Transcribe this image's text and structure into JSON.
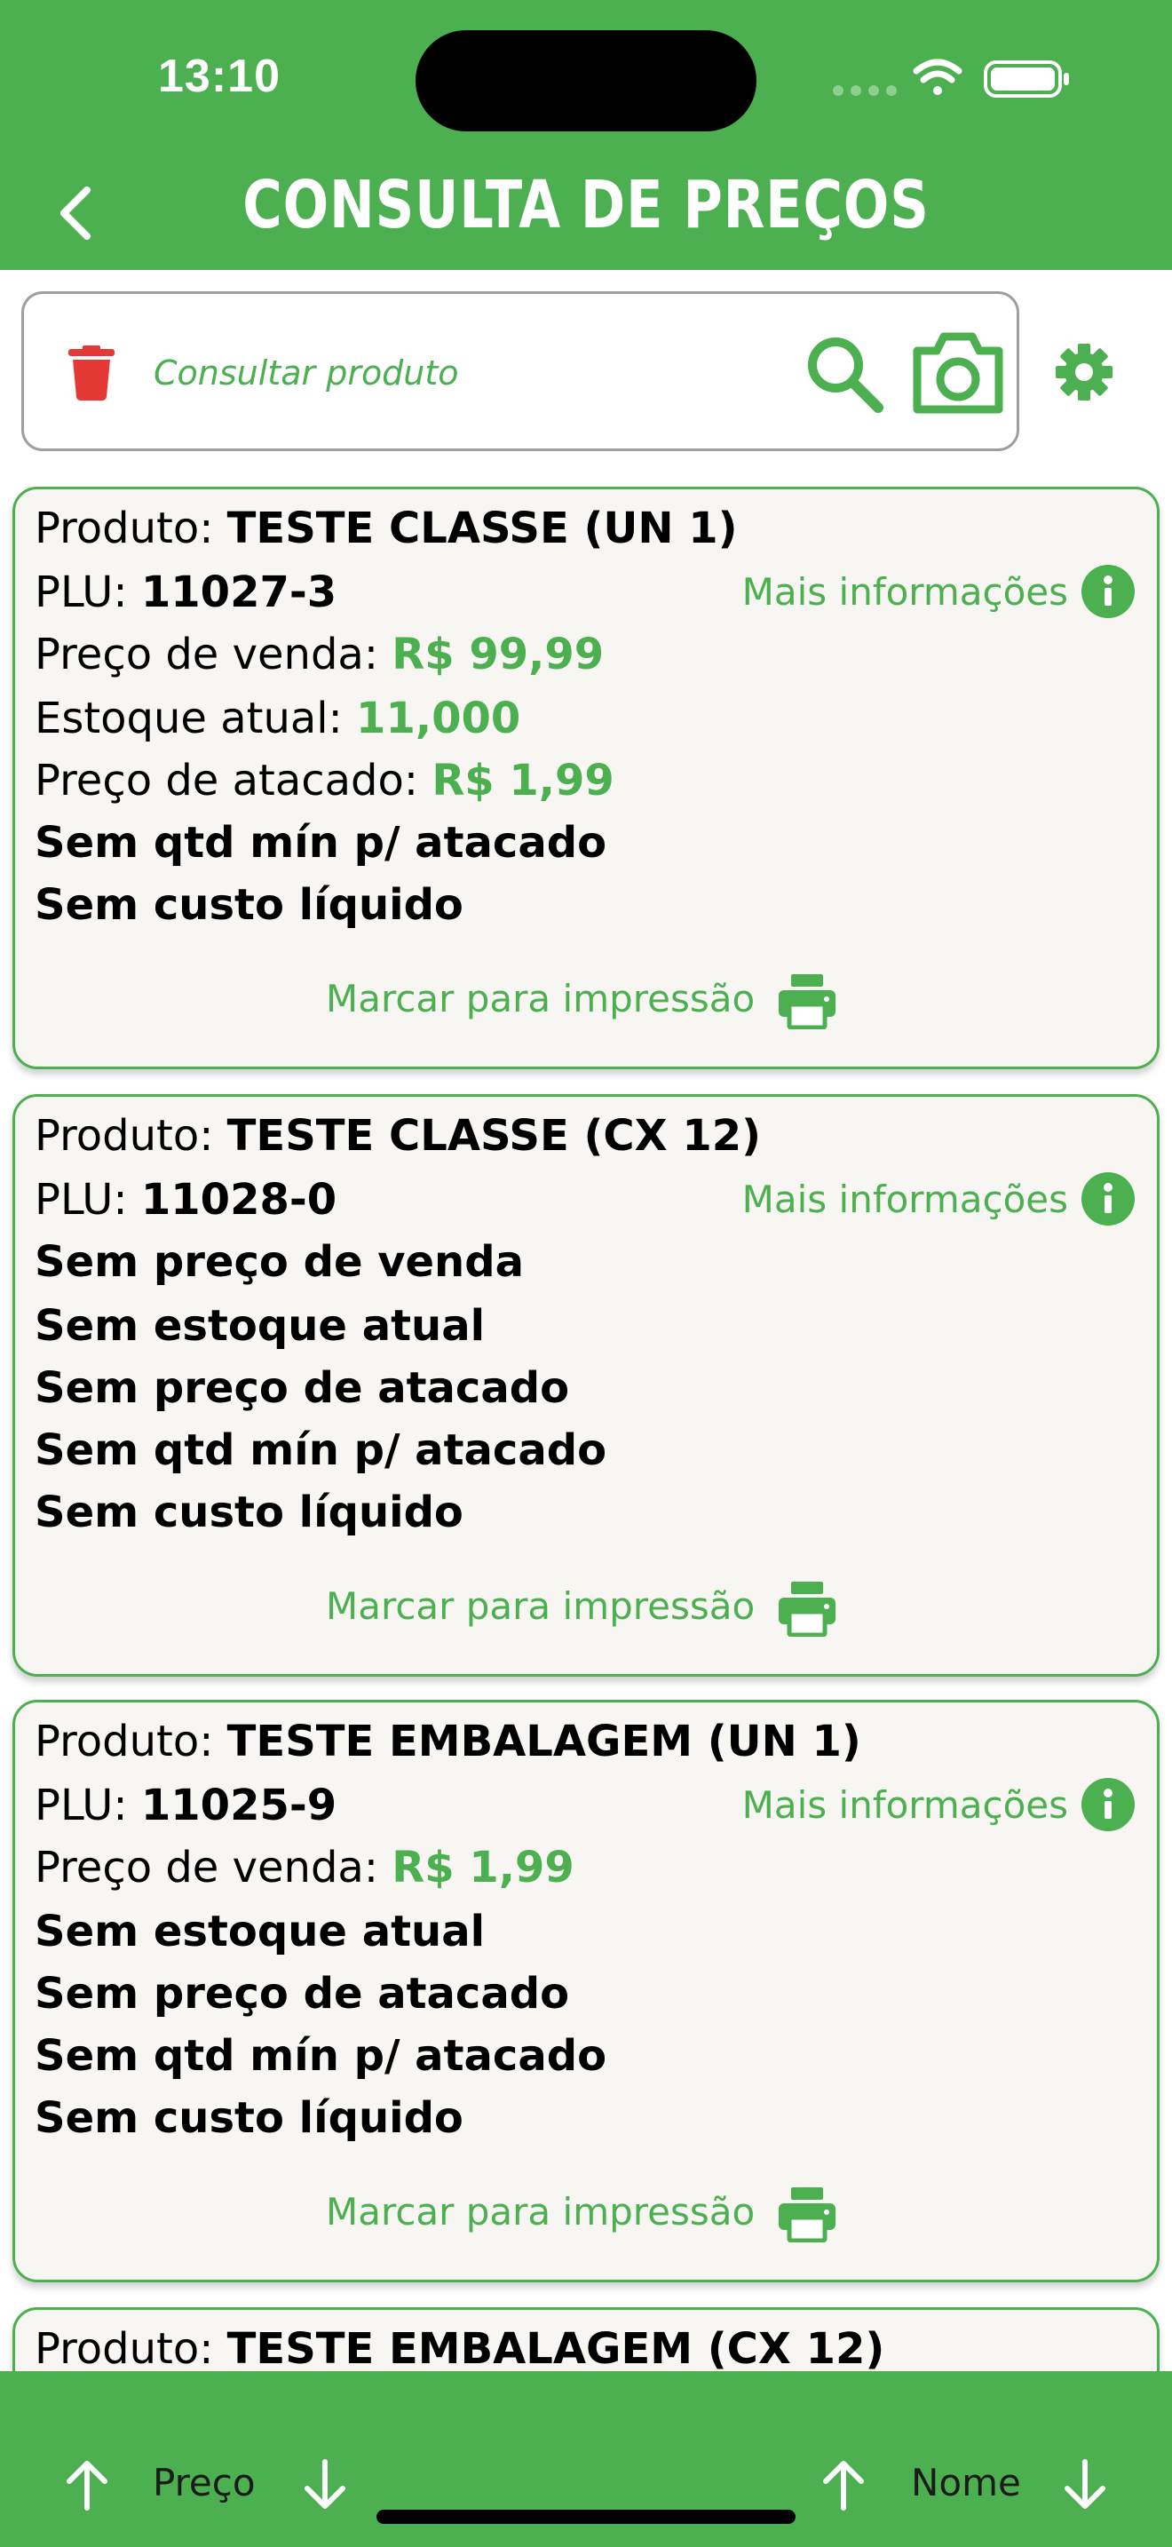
{
  "status_bar": {
    "time": "13:10"
  },
  "header": {
    "title": "CONSULTA DE PREÇOS"
  },
  "search": {
    "placeholder": "Consultar produto",
    "value": ""
  },
  "labels": {
    "produto": "Produto:",
    "plu": "PLU:",
    "preco_venda": "Preço de venda:",
    "estoque_atual": "Estoque atual:",
    "preco_atacado": "Preço de atacado:",
    "more_info": "Mais informações",
    "print": "Marcar para impressão"
  },
  "products": [
    {
      "name": "TESTE CLASSE (UN 1)",
      "plu": "11027-3",
      "preco_venda": "R$ 99,99",
      "estoque_atual": "11,000",
      "preco_atacado": "R$ 1,99",
      "sem_qtd_min": "Sem qtd mín p/ atacado",
      "sem_custo": "Sem custo líquido"
    },
    {
      "name": "TESTE CLASSE (CX 12)",
      "plu": "11028-0",
      "sem_preco_venda": "Sem preço de venda",
      "sem_estoque": "Sem estoque atual",
      "sem_preco_atacado": "Sem preço de atacado",
      "sem_qtd_min": "Sem qtd mín p/ atacado",
      "sem_custo": "Sem custo líquido"
    },
    {
      "name": "TESTE EMBALAGEM (UN 1)",
      "plu": "11025-9",
      "preco_venda": "R$ 1,99",
      "sem_estoque": "Sem estoque atual",
      "sem_preco_atacado": "Sem preço de atacado",
      "sem_qtd_min": "Sem qtd mín p/ atacado",
      "sem_custo": "Sem custo líquido"
    },
    {
      "name": "TESTE EMBALAGEM (CX 12)"
    }
  ],
  "sort_bar": {
    "price_label": "Preço",
    "name_label": "Nome"
  },
  "colors": {
    "brand": "#4caf50",
    "trash": "#e53935",
    "card_bg": "#f7f6f2"
  }
}
